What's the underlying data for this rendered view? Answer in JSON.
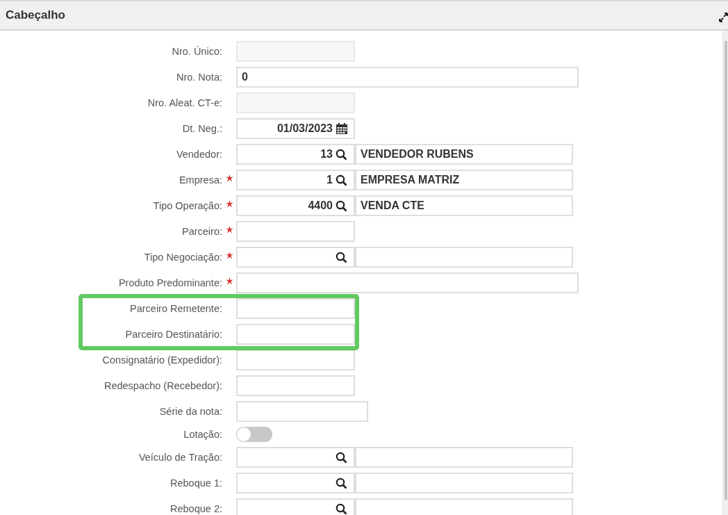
{
  "panel": {
    "title": "Cabeçalho"
  },
  "fields": [
    {
      "label": "Nro. Único:",
      "required": false,
      "highlighted": false,
      "kind": "readonly"
    },
    {
      "label": "Nro. Nota:",
      "required": false,
      "highlighted": false,
      "kind": "wide",
      "value": "0"
    },
    {
      "label": "Nro. Aleat. CT-e:",
      "required": false,
      "highlighted": false,
      "kind": "readonly"
    },
    {
      "label": "Dt. Neg.:",
      "required": false,
      "highlighted": false,
      "kind": "date",
      "value": "01/03/2023"
    },
    {
      "label": "Vendedor:",
      "required": false,
      "highlighted": false,
      "kind": "lookup",
      "value": "13",
      "description": "VENDEDOR RUBENS"
    },
    {
      "label": "Empresa:",
      "required": true,
      "highlighted": false,
      "kind": "lookup",
      "value": "1",
      "description": "EMPRESA MATRIZ"
    },
    {
      "label": "Tipo Operação:",
      "required": true,
      "highlighted": false,
      "kind": "lookup",
      "value": "4400",
      "description": "VENDA CTE"
    },
    {
      "label": "Parceiro:",
      "required": true,
      "highlighted": false,
      "kind": "text"
    },
    {
      "label": "Tipo Negociação:",
      "required": true,
      "highlighted": false,
      "kind": "lookup"
    },
    {
      "label": "Produto Predominante:",
      "required": true,
      "highlighted": false,
      "kind": "wide"
    },
    {
      "label": "Parceiro Remetente:",
      "required": false,
      "highlighted": true,
      "kind": "text"
    },
    {
      "label": "Parceiro Destinatário:",
      "required": false,
      "highlighted": true,
      "kind": "text"
    },
    {
      "label": "Consignatário (Expedidor):",
      "required": false,
      "highlighted": false,
      "kind": "text"
    },
    {
      "label": "Redespacho (Recebedor):",
      "required": false,
      "highlighted": false,
      "kind": "text"
    },
    {
      "label": "Série da nota:",
      "required": false,
      "highlighted": false,
      "kind": "medium"
    },
    {
      "label": "Lotação:",
      "required": false,
      "highlighted": false,
      "kind": "toggle",
      "on": false
    },
    {
      "label": "Veículo de Tração:",
      "required": false,
      "highlighted": false,
      "kind": "lookup"
    },
    {
      "label": "Reboque 1:",
      "required": false,
      "highlighted": false,
      "kind": "lookup"
    },
    {
      "label": "Reboque 2:",
      "required": false,
      "highlighted": false,
      "kind": "lookup"
    }
  ]
}
